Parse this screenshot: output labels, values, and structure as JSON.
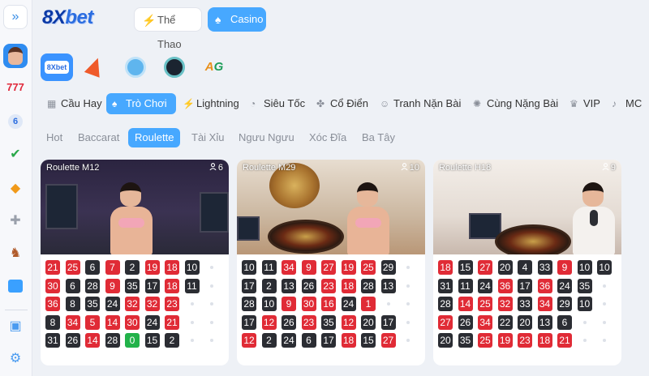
{
  "header": {
    "logo_prefix": "8X",
    "logo_suffix": "bet",
    "tabs": [
      {
        "label": "Thể Thao",
        "icon": "lightning-icon"
      },
      {
        "label": "Casino",
        "icon": "spade-icon",
        "active": true
      }
    ]
  },
  "rail": {
    "expand_icon": "double-chevron-right-icon",
    "items": [
      "avatar",
      "slot-777-icon",
      "lottery-ball-icon",
      "cards-check-icon",
      "fish-icon",
      "gamepad-icon",
      "horse-icon",
      "news-icon",
      "gift-icon",
      "settings-gear-icon"
    ]
  },
  "providers": {
    "p1_text": "8Xbet",
    "p5_text_a": "A",
    "p5_text_b": "G"
  },
  "categories": [
    {
      "label": "Cầu Hay",
      "icon": "grid-icon"
    },
    {
      "label": "Trò Chơi",
      "icon": "spade-icon",
      "active": true
    },
    {
      "label": "Lightning",
      "icon": "lightning-icon"
    },
    {
      "label": "Siêu Tốc",
      "icon": "speedometer-icon"
    },
    {
      "label": "Cổ Điển",
      "icon": "clover-icon"
    },
    {
      "label": "Tranh Nặn Bài",
      "icon": "dealer-icon"
    },
    {
      "label": "Cùng Nặng Bài",
      "icon": "settings-icon"
    },
    {
      "label": "VIP",
      "icon": "crown-icon"
    },
    {
      "label": "MC",
      "icon": "microphone-icon"
    }
  ],
  "subtabs": [
    "Hot",
    "Baccarat",
    "Roulette",
    "Tài Xỉu",
    "Ngưu Ngưu",
    "Xóc Đĩa",
    "Ba Tây"
  ],
  "subtab_active": "Roulette",
  "tables": [
    {
      "name": "Roulette M12",
      "players": "6",
      "rows": [
        [
          [
            "21",
            "r"
          ],
          [
            "25",
            "r"
          ],
          [
            "6",
            "b"
          ],
          [
            "7",
            "r"
          ],
          [
            "2",
            "b"
          ],
          [
            "19",
            "r"
          ],
          [
            "18",
            "r"
          ],
          [
            "10",
            "b"
          ]
        ],
        [
          [
            "30",
            "r"
          ],
          [
            "6",
            "b"
          ],
          [
            "28",
            "b"
          ],
          [
            "9",
            "r"
          ],
          [
            "35",
            "b"
          ],
          [
            "17",
            "b"
          ],
          [
            "18",
            "r"
          ],
          [
            "11",
            "b"
          ]
        ],
        [
          [
            "36",
            "r"
          ],
          [
            "8",
            "b"
          ],
          [
            "35",
            "b"
          ],
          [
            "24",
            "b"
          ],
          [
            "32",
            "r"
          ],
          [
            "32",
            "r"
          ],
          [
            "23",
            "r"
          ]
        ],
        [
          [
            "8",
            "b"
          ],
          [
            "34",
            "r"
          ],
          [
            "5",
            "r"
          ],
          [
            "14",
            "r"
          ],
          [
            "30",
            "r"
          ],
          [
            "24",
            "b"
          ],
          [
            "21",
            "r"
          ]
        ],
        [
          [
            "31",
            "b"
          ],
          [
            "26",
            "b"
          ],
          [
            "14",
            "r"
          ],
          [
            "28",
            "b"
          ],
          [
            "0",
            "g"
          ],
          [
            "15",
            "b"
          ],
          [
            "2",
            "b"
          ]
        ]
      ]
    },
    {
      "name": "Roulette M29",
      "players": "10",
      "rows": [
        [
          [
            "10",
            "b"
          ],
          [
            "11",
            "b"
          ],
          [
            "34",
            "r"
          ],
          [
            "9",
            "r"
          ],
          [
            "27",
            "r"
          ],
          [
            "19",
            "r"
          ],
          [
            "25",
            "r"
          ],
          [
            "29",
            "b"
          ]
        ],
        [
          [
            "17",
            "b"
          ],
          [
            "2",
            "b"
          ],
          [
            "13",
            "b"
          ],
          [
            "26",
            "b"
          ],
          [
            "23",
            "r"
          ],
          [
            "18",
            "r"
          ],
          [
            "28",
            "b"
          ],
          [
            "13",
            "b"
          ]
        ],
        [
          [
            "28",
            "b"
          ],
          [
            "10",
            "b"
          ],
          [
            "9",
            "r"
          ],
          [
            "30",
            "r"
          ],
          [
            "16",
            "r"
          ],
          [
            "24",
            "b"
          ],
          [
            "1",
            "r"
          ]
        ],
        [
          [
            "17",
            "b"
          ],
          [
            "12",
            "r"
          ],
          [
            "26",
            "b"
          ],
          [
            "23",
            "r"
          ],
          [
            "35",
            "b"
          ],
          [
            "12",
            "r"
          ],
          [
            "20",
            "b"
          ],
          [
            "17",
            "b"
          ]
        ],
        [
          [
            "12",
            "r"
          ],
          [
            "2",
            "b"
          ],
          [
            "24",
            "b"
          ],
          [
            "6",
            "b"
          ],
          [
            "17",
            "b"
          ],
          [
            "18",
            "r"
          ],
          [
            "15",
            "b"
          ],
          [
            "27",
            "r"
          ]
        ]
      ]
    },
    {
      "name": "Roulette H18",
      "players": "9",
      "rows": [
        [
          [
            "18",
            "r"
          ],
          [
            "15",
            "b"
          ],
          [
            "27",
            "r"
          ],
          [
            "20",
            "b"
          ],
          [
            "4",
            "b"
          ],
          [
            "33",
            "b"
          ],
          [
            "9",
            "r"
          ],
          [
            "10",
            "b"
          ],
          [
            "10",
            "b"
          ]
        ],
        [
          [
            "31",
            "b"
          ],
          [
            "11",
            "b"
          ],
          [
            "24",
            "b"
          ],
          [
            "36",
            "r"
          ],
          [
            "17",
            "b"
          ],
          [
            "36",
            "r"
          ],
          [
            "24",
            "b"
          ],
          [
            "35",
            "b"
          ]
        ],
        [
          [
            "28",
            "b"
          ],
          [
            "14",
            "r"
          ],
          [
            "25",
            "r"
          ],
          [
            "32",
            "r"
          ],
          [
            "33",
            "b"
          ],
          [
            "34",
            "r"
          ],
          [
            "29",
            "b"
          ],
          [
            "10",
            "b"
          ]
        ],
        [
          [
            "27",
            "r"
          ],
          [
            "26",
            "b"
          ],
          [
            "34",
            "r"
          ],
          [
            "22",
            "b"
          ],
          [
            "20",
            "b"
          ],
          [
            "13",
            "b"
          ],
          [
            "6",
            "b"
          ]
        ],
        [
          [
            "20",
            "b"
          ],
          [
            "35",
            "b"
          ],
          [
            "25",
            "r"
          ],
          [
            "19",
            "r"
          ],
          [
            "23",
            "r"
          ],
          [
            "18",
            "r"
          ],
          [
            "21",
            "r"
          ]
        ]
      ]
    }
  ]
}
